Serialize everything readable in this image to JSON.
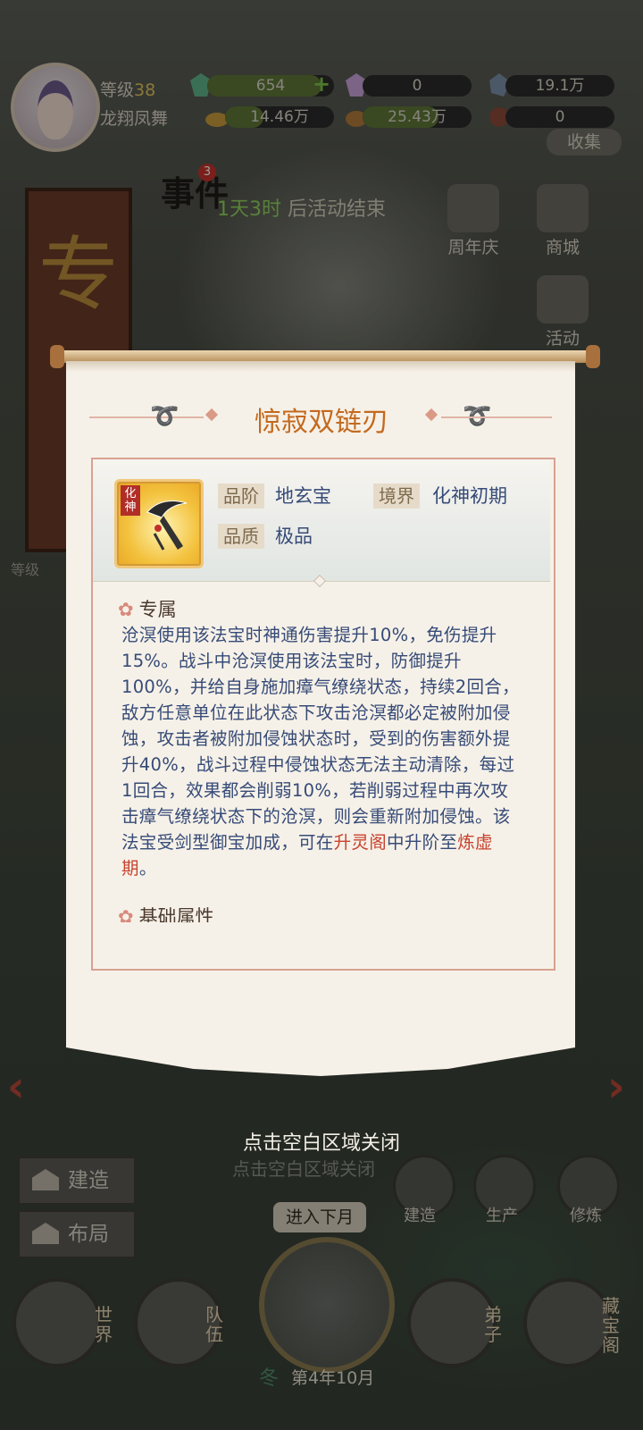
{
  "player": {
    "level_label": "等级",
    "level": "38",
    "name": "龙翔凤舞"
  },
  "resources": [
    {
      "value": "654",
      "icon": "green-crystal-icon",
      "fill": 0.9,
      "has_plus": true
    },
    {
      "value": "0",
      "icon": "rainbow-crystal-icon",
      "fill": 0
    },
    {
      "value": "19.1万",
      "icon": "blue-crystal-icon",
      "fill": 0
    },
    {
      "value": "14.46万",
      "icon": "gold-ingot-icon",
      "fill": 0.35
    },
    {
      "value": "25.43万",
      "icon": "ore-icon",
      "fill": 0.7
    },
    {
      "value": "0",
      "icon": "red-orb-icon",
      "fill": 0
    }
  ],
  "event": {
    "title": "事件",
    "badge": "3",
    "time_highlight": "1天3时",
    "time_suffix": "后活动结束"
  },
  "side_buttons": [
    {
      "label": "周年庆"
    },
    {
      "label": "商城"
    },
    {
      "label": "活动"
    }
  ],
  "collect_label": "收集",
  "level_small": "等级",
  "modal": {
    "title": "惊寂双链刃",
    "item_tag": "化神",
    "attrs": {
      "grade_label": "品阶",
      "grade": "地玄宝",
      "realm_label": "境界",
      "realm": "化神初期",
      "quality_label": "品质",
      "quality": "极品"
    },
    "section_exclusive": "专属",
    "desc_parts": {
      "p1": "沧溟使用该法宝时神通伤害提升10%，免伤提升15%。战斗中沧溟使用该法宝时，防御提升100%，并给自身施加瘴气缭绕状态，持续2回合，敌方任意单位在此状态下攻击沧溟都必定被附加侵蚀，攻击者被附加侵蚀状态时，受到的伤害额外提升40%，战斗过程中侵蚀状态无法主动清除，每过1回合，效果都会削弱10%，若削弱过程中再次攻击瘴气缭绕状态下的沧溟，则会重新附加侵蚀。该法宝受剑型御宝加成，可在",
      "r1": "升灵阁",
      "p2": "中升阶至",
      "r2": "炼虚期",
      "p3": "。"
    },
    "section_base": "基础属性"
  },
  "close_hint": "点击空白区域关闭",
  "close_hint_bg": "点击空白区域关闭",
  "left_buttons": {
    "build": "建造",
    "layout": "布局"
  },
  "right_buttons": {
    "build": "建造",
    "produce": "生产",
    "cultivate": "修炼"
  },
  "bottom_nav": {
    "world": "世界",
    "team": "队伍",
    "disciple": "弟子",
    "treasury": "藏宝阁"
  },
  "season": {
    "enter_next": "进入下月",
    "season": "冬",
    "date": "第4年10月"
  },
  "colors": {
    "title": "#c46a1f",
    "text_blue": "#364b78",
    "highlight_red": "#c8432f",
    "panel_border": "#d8a291"
  }
}
